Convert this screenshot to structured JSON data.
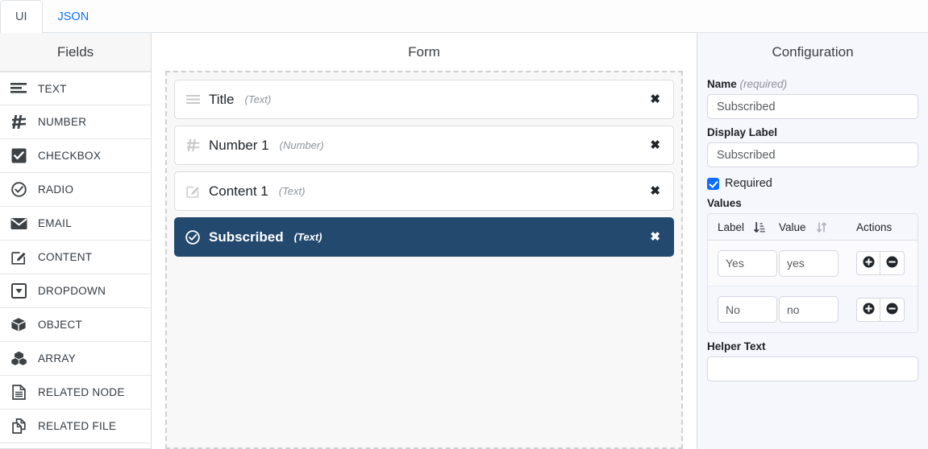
{
  "tabs": [
    {
      "label": "UI",
      "active": true
    },
    {
      "label": "JSON",
      "active": false
    }
  ],
  "fields_panel": {
    "title": "Fields",
    "items": [
      {
        "label": "TEXT",
        "icon": "text-lines-icon"
      },
      {
        "label": "NUMBER",
        "icon": "hash-icon"
      },
      {
        "label": "CHECKBOX",
        "icon": "checkbox-checked-icon"
      },
      {
        "label": "RADIO",
        "icon": "radio-check-circle-icon"
      },
      {
        "label": "EMAIL",
        "icon": "envelope-icon"
      },
      {
        "label": "CONTENT",
        "icon": "pencil-square-icon"
      },
      {
        "label": "DROPDOWN",
        "icon": "caret-down-square-icon"
      },
      {
        "label": "OBJECT",
        "icon": "cube-icon"
      },
      {
        "label": "ARRAY",
        "icon": "cubes-icon"
      },
      {
        "label": "RELATED NODE",
        "icon": "document-lines-icon"
      },
      {
        "label": "RELATED FILE",
        "icon": "copy-files-icon"
      }
    ]
  },
  "form_panel": {
    "title": "Form",
    "remove_glyph": "✖",
    "rows": [
      {
        "label": "Title",
        "type": "(Text)",
        "icon": "text-lines-icon",
        "selected": false
      },
      {
        "label": "Number 1",
        "type": "(Number)",
        "icon": "hash-icon",
        "selected": false
      },
      {
        "label": "Content 1",
        "type": "(Text)",
        "icon": "pencil-square-icon",
        "selected": false
      },
      {
        "label": "Subscribed",
        "type": "(Text)",
        "icon": "radio-check-circle-icon",
        "selected": true
      }
    ]
  },
  "config_panel": {
    "title": "Configuration",
    "name": {
      "label": "Name",
      "label_suffix": "(required)",
      "value": "Subscribed",
      "placeholder": "Subscribed"
    },
    "display_label": {
      "label": "Display Label",
      "value": "Subscribed",
      "placeholder": "Subscribed"
    },
    "required": {
      "label": "Required",
      "checked": true
    },
    "values": {
      "label": "Values",
      "columns": [
        {
          "header": "Label",
          "sort_icon": "sort-amount-down-icon",
          "sort_active": true
        },
        {
          "header": "Value",
          "sort_icon": "sort-updown-icon",
          "sort_active": false
        },
        {
          "header": "Actions",
          "sort_icon": "",
          "sort_active": false
        }
      ],
      "rows": [
        {
          "label": "Yes",
          "value": "yes",
          "add_label": "add-row",
          "remove_label": "remove-row"
        },
        {
          "label": "No",
          "value": "no",
          "add_label": "add-row",
          "remove_label": "remove-row"
        }
      ]
    },
    "helper_text": {
      "label": "Helper Text",
      "value": "",
      "placeholder": ""
    }
  },
  "colors": {
    "accent_blue": "#0d6efd",
    "selected_row": "#23496e",
    "config_bg": "#f6f6fd",
    "fields_bg": "#f7f7f8",
    "canvas_bg": "#f8f8f8"
  }
}
